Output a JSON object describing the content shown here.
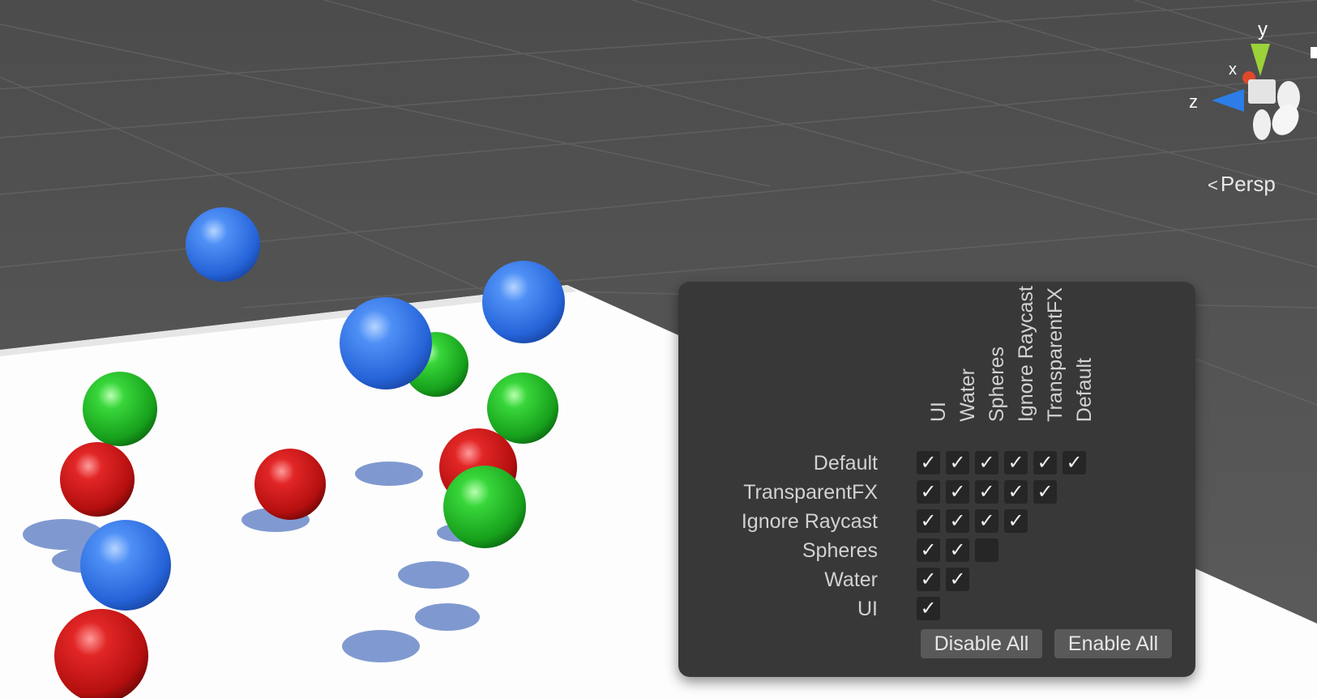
{
  "scene_view": {
    "projection_label": "Persp",
    "gizmo": {
      "axis_x": "x",
      "axis_y": "y",
      "axis_z": "z"
    }
  },
  "layer_matrix": {
    "columns": [
      "UI",
      "Water",
      "Spheres",
      "Ignore Raycast",
      "TransparentFX",
      "Default"
    ],
    "rows": [
      {
        "label": "Default",
        "checks": [
          true,
          true,
          true,
          true,
          true,
          true
        ]
      },
      {
        "label": "TransparentFX",
        "checks": [
          true,
          true,
          true,
          true,
          true
        ]
      },
      {
        "label": "Ignore Raycast",
        "checks": [
          true,
          true,
          true,
          true
        ]
      },
      {
        "label": "Spheres",
        "checks": [
          true,
          true,
          false
        ]
      },
      {
        "label": "Water",
        "checks": [
          true,
          true
        ]
      },
      {
        "label": "UI",
        "checks": [
          true
        ]
      }
    ],
    "check_glyph": "✓",
    "buttons": {
      "disable_all": "Disable All",
      "enable_all": "Enable All"
    }
  },
  "colors": {
    "sky": "#555555",
    "floor": "#ffffff",
    "panel": "#383838",
    "blue_sphere": "#2f6fde",
    "green_sphere": "#1fb424",
    "red_sphere": "#c41414",
    "gizmo_x": "#e0482a",
    "gizmo_y": "#9bd23a",
    "gizmo_z": "#2c7de8"
  }
}
